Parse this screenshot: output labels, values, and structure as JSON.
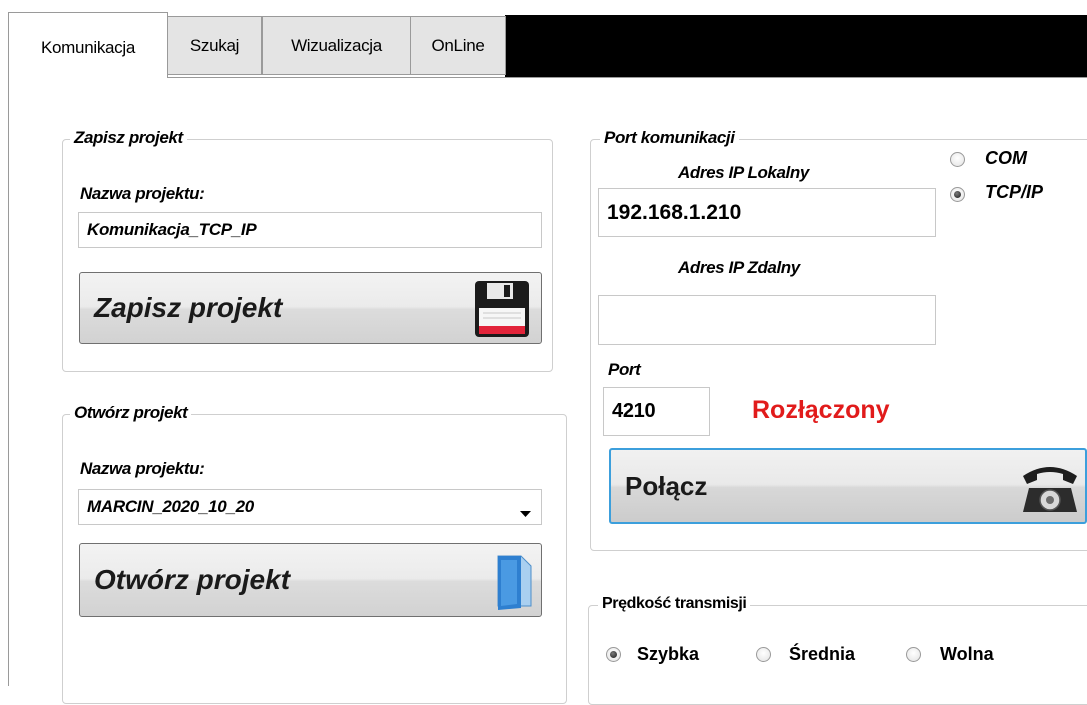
{
  "tabs": [
    {
      "label": "Komunikacja",
      "active": true
    },
    {
      "label": "Szukaj",
      "active": false
    },
    {
      "label": "Wizualizacja",
      "active": false
    },
    {
      "label": "OnLine",
      "active": false
    }
  ],
  "save_group": {
    "title": "Zapisz projekt",
    "name_label": "Nazwa projektu:",
    "name_value": "Komunikacja_TCP_IP",
    "button_label": "Zapisz projekt",
    "button_icon": "floppy-disk-icon"
  },
  "open_group": {
    "title": "Otwórz projekt",
    "name_label": "Nazwa projektu:",
    "selected_project": "MARCIN_2020_10_20",
    "button_label": "Otwórz projekt",
    "button_icon": "folder-icon"
  },
  "port_group": {
    "title": "Port komunikacji",
    "local_ip_label": "Adres IP Lokalny",
    "local_ip_value": "192.168.1.210",
    "remote_ip_label": "Adres IP Zdalny",
    "remote_ip_value": "",
    "port_label": "Port",
    "port_value": "4210",
    "status_text": "Rozłączony",
    "status_color": "#e11b1b",
    "connect_label": "Połącz",
    "connect_icon": "telephone-icon",
    "modes": [
      {
        "label": "COM",
        "selected": false
      },
      {
        "label": "TCP/IP",
        "selected": true
      }
    ]
  },
  "speed_group": {
    "title": "Prędkość transmisji",
    "options": [
      {
        "label": "Szybka",
        "selected": true
      },
      {
        "label": "Średnia",
        "selected": false
      },
      {
        "label": "Wolna",
        "selected": false
      }
    ]
  }
}
